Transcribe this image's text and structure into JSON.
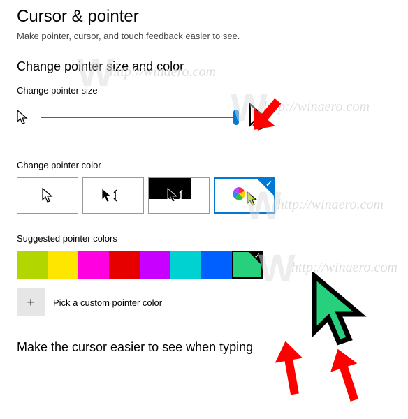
{
  "page_title": "Cursor & pointer",
  "page_description": "Make pointer, cursor, and touch feedback easier to see.",
  "section_size_color": "Change pointer size and color",
  "label_pointer_size": "Change pointer size",
  "label_pointer_color": "Change pointer color",
  "label_suggested_colors": "Suggested pointer colors",
  "custom_color_label": "Pick a custom pointer color",
  "section_typing": "Make the cursor easier to see when typing",
  "pointer_color_options": [
    {
      "id": "white",
      "selected": false
    },
    {
      "id": "black",
      "selected": false
    },
    {
      "id": "inverted",
      "selected": false
    },
    {
      "id": "custom",
      "selected": true
    }
  ],
  "suggested_colors": [
    {
      "hex": "#b2d600",
      "selected": false
    },
    {
      "hex": "#ffe600",
      "selected": false
    },
    {
      "hex": "#ff00e1",
      "selected": false
    },
    {
      "hex": "#e60000",
      "selected": false
    },
    {
      "hex": "#c700ff",
      "selected": false
    },
    {
      "hex": "#00d1d1",
      "selected": false
    },
    {
      "hex": "#0060ff",
      "selected": false
    },
    {
      "hex": "#26d07c",
      "selected": true
    }
  ],
  "accent_color": "#0078d4",
  "watermark_text": "http://winaero.com"
}
